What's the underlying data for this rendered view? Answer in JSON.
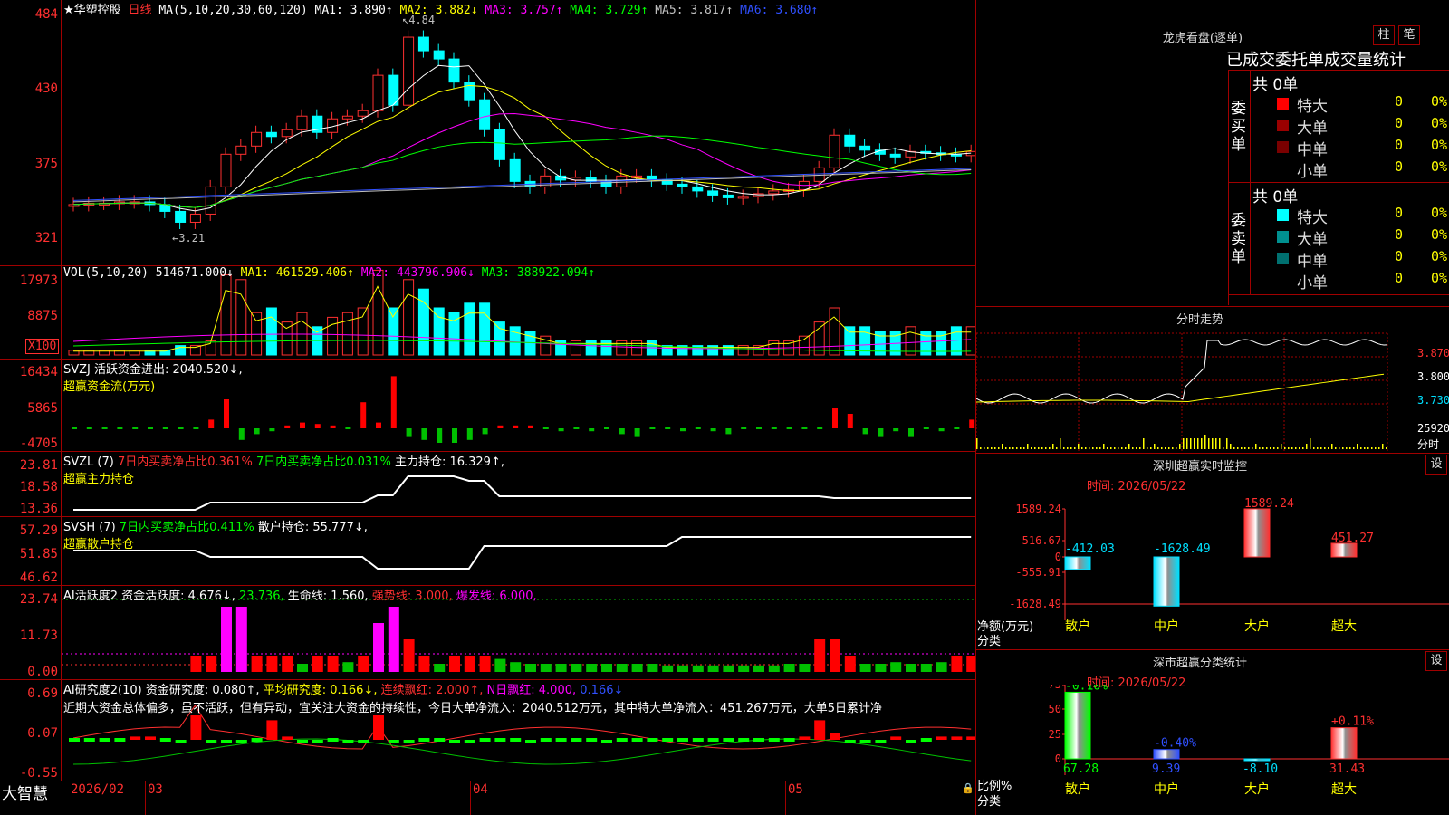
{
  "stock": {
    "name": "★华塑控股",
    "period": "日线",
    "ma_params": "MA(5,10,20,30,60,120)"
  },
  "price_panel": {
    "ma1": "MA1: 3.890↑",
    "ma2": "MA2: 3.882↓",
    "ma3": "MA3: 3.757↑",
    "ma4": "MA4: 3.729↑",
    "ma5": "MA5: 3.817↑",
    "ma6": "MA6: 3.680↑",
    "y_labels": [
      "484",
      "430",
      "375",
      "321"
    ],
    "high_mark": "4.84",
    "low_mark": "3.21"
  },
  "vol_panel": {
    "label": "VOL(5,10,20)",
    "vol": "514671.000↓",
    "ma1": "MA1: 461529.406↑",
    "ma2": "MA2: 443796.906↓",
    "ma3": "MA3: 388922.094↑",
    "y_labels": [
      "17973",
      "8875"
    ],
    "unit": "X100"
  },
  "svzj_panel": {
    "l1": "SVZJ  活跃资金进出: 2040.520↓,",
    "l2": "超赢资金流(万元)",
    "y_labels": [
      "16434",
      "5865",
      "-4705"
    ]
  },
  "svzl_panel": {
    "prefix": "SVZL (7)",
    "a": "7日内买卖净占比0.361%",
    "b": "7日内买卖净占比0.031%",
    "c": "主力持仓: 16.329↑,",
    "l2": "超赢主力持仓",
    "y_labels": [
      "23.81",
      "18.58",
      "13.36"
    ]
  },
  "svsh_panel": {
    "prefix": "SVSH (7)",
    "a": "7日内买卖净占比0.411%",
    "b": "散户持仓: 55.777↓,",
    "l2": "超赢散户持仓",
    "y_labels": [
      "57.29",
      "51.85",
      "46.62"
    ]
  },
  "ai_active": {
    "a": "AI活跃度2 资金活跃度: 4.676↓,",
    "b": "23.736,",
    "c": "生命线: 1.560,",
    "d": "强势线: 3.000,",
    "e": "爆发线: 6.000,",
    "y_labels": [
      "23.74",
      "11.73",
      "0.00"
    ]
  },
  "ai_research": {
    "a": "AI研究度2(10) 资金研究度: 0.080↑,",
    "b": "平均研究度: 0.166↓,",
    "c": "连续飘红: 2.000↑,",
    "d": "N日飘红: 4.000,",
    "e": "0.166↓",
    "comment": "近期大资金总体偏多，虽不活跃，但有异动，宜关注大资金的持续性，今日大单净流入：2040.512万元，其中特大单净流入：451.267万元，大单5日累计净",
    "y_labels": [
      "0.69",
      "0.07",
      "-0.55"
    ]
  },
  "footer": {
    "brand": "大智慧",
    "dates": [
      "2026/02",
      "03",
      "04",
      "05"
    ]
  },
  "right": {
    "lhb_title": "龙虎看盘(逐单)",
    "btn_zhu": "柱",
    "btn_bi": "笔",
    "subtitle": "已成交委托单成交量统计",
    "buy": {
      "label": "委买单",
      "total": "共 0单",
      "rows": [
        {
          "name": "特大",
          "value": "0",
          "pct": "0%",
          "color": "#ff0000"
        },
        {
          "name": "大单",
          "value": "0",
          "pct": "0%",
          "color": "#9a0000"
        },
        {
          "name": "中单",
          "value": "0",
          "pct": "0%",
          "color": "#7a0000"
        },
        {
          "name": "小单",
          "value": "0",
          "pct": "0%",
          "color": "#000000"
        }
      ]
    },
    "sell": {
      "label": "委卖单",
      "total": "共 0单",
      "rows": [
        {
          "name": "特大",
          "value": "0",
          "pct": "0%",
          "color": "#00ffff"
        },
        {
          "name": "大单",
          "value": "0",
          "pct": "0%",
          "color": "#009090"
        },
        {
          "name": "中单",
          "value": "0",
          "pct": "0%",
          "color": "#007070"
        },
        {
          "name": "小单",
          "value": "0",
          "pct": "0%",
          "color": "#000000"
        }
      ]
    },
    "intraday": {
      "title": "分时走势",
      "y_labels": [
        "3.870",
        "3.800",
        "3.730"
      ],
      "vol_label": "25920",
      "unit": "分时"
    },
    "sz_monitor": {
      "title": "深圳超赢实时监控",
      "btn": "设",
      "time": "时间: 2026/05/22",
      "y_labels": [
        "1589.24",
        "516.67",
        "0",
        "-555.91",
        "-1628.49"
      ],
      "axis_title": "净额(万元)",
      "cat_label": "分类"
    },
    "sz_class": {
      "title": "深市超赢分类统计",
      "btn": "设",
      "time": "时间: 2026/05/22",
      "y_labels": [
        "75",
        "50",
        "25",
        "0"
      ],
      "axis_title": "比例%",
      "cat_label": "分类"
    }
  },
  "chart_data": [
    {
      "type": "bar",
      "title": "深圳超赢实时监控",
      "ylabel": "净额(万元)",
      "categories": [
        "散户",
        "中户",
        "大户",
        "超大"
      ],
      "values": [
        -412.03,
        -1628.49,
        1589.24,
        451.27
      ],
      "ylim": [
        -1628.49,
        1589.24
      ]
    },
    {
      "type": "bar",
      "title": "深市超赢分类统计",
      "ylabel": "比例%",
      "categories": [
        "散户",
        "中户",
        "大户",
        "超大"
      ],
      "values": [
        67.28,
        9.39,
        -8.1,
        31.43
      ],
      "changes": [
        "-0.10%",
        "-0.40%",
        "",
        "+0.11%"
      ],
      "ylim": [
        0,
        75
      ]
    }
  ]
}
